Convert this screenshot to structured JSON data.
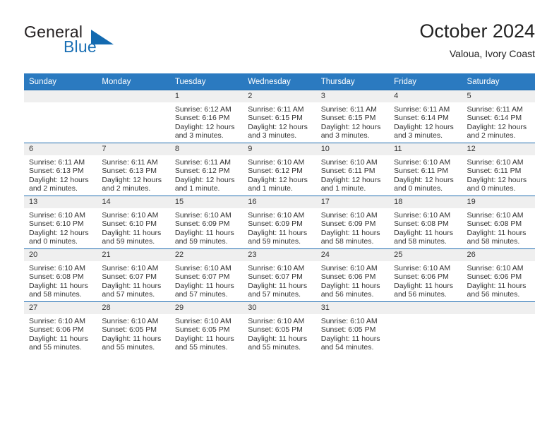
{
  "brand": {
    "word1": "General",
    "word2": "Blue",
    "logo_icon": "triangle-icon",
    "accent_color": "#136ab0"
  },
  "header": {
    "title": "October 2024",
    "subtitle": "Valoua, Ivory Coast"
  },
  "calendar": {
    "header_bg": "#2b7ac0",
    "border_color": "#1f6cb0",
    "daynum_bg": "#efefef",
    "weekday_headers": [
      "Sunday",
      "Monday",
      "Tuesday",
      "Wednesday",
      "Thursday",
      "Friday",
      "Saturday"
    ],
    "weeks": [
      [
        {
          "day": "",
          "lines": []
        },
        {
          "day": "",
          "lines": []
        },
        {
          "day": "1",
          "lines": [
            "Sunrise: 6:12 AM",
            "Sunset: 6:16 PM",
            "Daylight: 12 hours",
            "and 3 minutes."
          ]
        },
        {
          "day": "2",
          "lines": [
            "Sunrise: 6:11 AM",
            "Sunset: 6:15 PM",
            "Daylight: 12 hours",
            "and 3 minutes."
          ]
        },
        {
          "day": "3",
          "lines": [
            "Sunrise: 6:11 AM",
            "Sunset: 6:15 PM",
            "Daylight: 12 hours",
            "and 3 minutes."
          ]
        },
        {
          "day": "4",
          "lines": [
            "Sunrise: 6:11 AM",
            "Sunset: 6:14 PM",
            "Daylight: 12 hours",
            "and 3 minutes."
          ]
        },
        {
          "day": "5",
          "lines": [
            "Sunrise: 6:11 AM",
            "Sunset: 6:14 PM",
            "Daylight: 12 hours",
            "and 2 minutes."
          ]
        }
      ],
      [
        {
          "day": "6",
          "lines": [
            "Sunrise: 6:11 AM",
            "Sunset: 6:13 PM",
            "Daylight: 12 hours",
            "and 2 minutes."
          ]
        },
        {
          "day": "7",
          "lines": [
            "Sunrise: 6:11 AM",
            "Sunset: 6:13 PM",
            "Daylight: 12 hours",
            "and 2 minutes."
          ]
        },
        {
          "day": "8",
          "lines": [
            "Sunrise: 6:11 AM",
            "Sunset: 6:12 PM",
            "Daylight: 12 hours",
            "and 1 minute."
          ]
        },
        {
          "day": "9",
          "lines": [
            "Sunrise: 6:10 AM",
            "Sunset: 6:12 PM",
            "Daylight: 12 hours",
            "and 1 minute."
          ]
        },
        {
          "day": "10",
          "lines": [
            "Sunrise: 6:10 AM",
            "Sunset: 6:11 PM",
            "Daylight: 12 hours",
            "and 1 minute."
          ]
        },
        {
          "day": "11",
          "lines": [
            "Sunrise: 6:10 AM",
            "Sunset: 6:11 PM",
            "Daylight: 12 hours",
            "and 0 minutes."
          ]
        },
        {
          "day": "12",
          "lines": [
            "Sunrise: 6:10 AM",
            "Sunset: 6:11 PM",
            "Daylight: 12 hours",
            "and 0 minutes."
          ]
        }
      ],
      [
        {
          "day": "13",
          "lines": [
            "Sunrise: 6:10 AM",
            "Sunset: 6:10 PM",
            "Daylight: 12 hours",
            "and 0 minutes."
          ]
        },
        {
          "day": "14",
          "lines": [
            "Sunrise: 6:10 AM",
            "Sunset: 6:10 PM",
            "Daylight: 11 hours",
            "and 59 minutes."
          ]
        },
        {
          "day": "15",
          "lines": [
            "Sunrise: 6:10 AM",
            "Sunset: 6:09 PM",
            "Daylight: 11 hours",
            "and 59 minutes."
          ]
        },
        {
          "day": "16",
          "lines": [
            "Sunrise: 6:10 AM",
            "Sunset: 6:09 PM",
            "Daylight: 11 hours",
            "and 59 minutes."
          ]
        },
        {
          "day": "17",
          "lines": [
            "Sunrise: 6:10 AM",
            "Sunset: 6:09 PM",
            "Daylight: 11 hours",
            "and 58 minutes."
          ]
        },
        {
          "day": "18",
          "lines": [
            "Sunrise: 6:10 AM",
            "Sunset: 6:08 PM",
            "Daylight: 11 hours",
            "and 58 minutes."
          ]
        },
        {
          "day": "19",
          "lines": [
            "Sunrise: 6:10 AM",
            "Sunset: 6:08 PM",
            "Daylight: 11 hours",
            "and 58 minutes."
          ]
        }
      ],
      [
        {
          "day": "20",
          "lines": [
            "Sunrise: 6:10 AM",
            "Sunset: 6:08 PM",
            "Daylight: 11 hours",
            "and 58 minutes."
          ]
        },
        {
          "day": "21",
          "lines": [
            "Sunrise: 6:10 AM",
            "Sunset: 6:07 PM",
            "Daylight: 11 hours",
            "and 57 minutes."
          ]
        },
        {
          "day": "22",
          "lines": [
            "Sunrise: 6:10 AM",
            "Sunset: 6:07 PM",
            "Daylight: 11 hours",
            "and 57 minutes."
          ]
        },
        {
          "day": "23",
          "lines": [
            "Sunrise: 6:10 AM",
            "Sunset: 6:07 PM",
            "Daylight: 11 hours",
            "and 57 minutes."
          ]
        },
        {
          "day": "24",
          "lines": [
            "Sunrise: 6:10 AM",
            "Sunset: 6:06 PM",
            "Daylight: 11 hours",
            "and 56 minutes."
          ]
        },
        {
          "day": "25",
          "lines": [
            "Sunrise: 6:10 AM",
            "Sunset: 6:06 PM",
            "Daylight: 11 hours",
            "and 56 minutes."
          ]
        },
        {
          "day": "26",
          "lines": [
            "Sunrise: 6:10 AM",
            "Sunset: 6:06 PM",
            "Daylight: 11 hours",
            "and 56 minutes."
          ]
        }
      ],
      [
        {
          "day": "27",
          "lines": [
            "Sunrise: 6:10 AM",
            "Sunset: 6:06 PM",
            "Daylight: 11 hours",
            "and 55 minutes."
          ]
        },
        {
          "day": "28",
          "lines": [
            "Sunrise: 6:10 AM",
            "Sunset: 6:05 PM",
            "Daylight: 11 hours",
            "and 55 minutes."
          ]
        },
        {
          "day": "29",
          "lines": [
            "Sunrise: 6:10 AM",
            "Sunset: 6:05 PM",
            "Daylight: 11 hours",
            "and 55 minutes."
          ]
        },
        {
          "day": "30",
          "lines": [
            "Sunrise: 6:10 AM",
            "Sunset: 6:05 PM",
            "Daylight: 11 hours",
            "and 55 minutes."
          ]
        },
        {
          "day": "31",
          "lines": [
            "Sunrise: 6:10 AM",
            "Sunset: 6:05 PM",
            "Daylight: 11 hours",
            "and 54 minutes."
          ]
        },
        {
          "day": "",
          "lines": []
        },
        {
          "day": "",
          "lines": []
        }
      ]
    ]
  }
}
